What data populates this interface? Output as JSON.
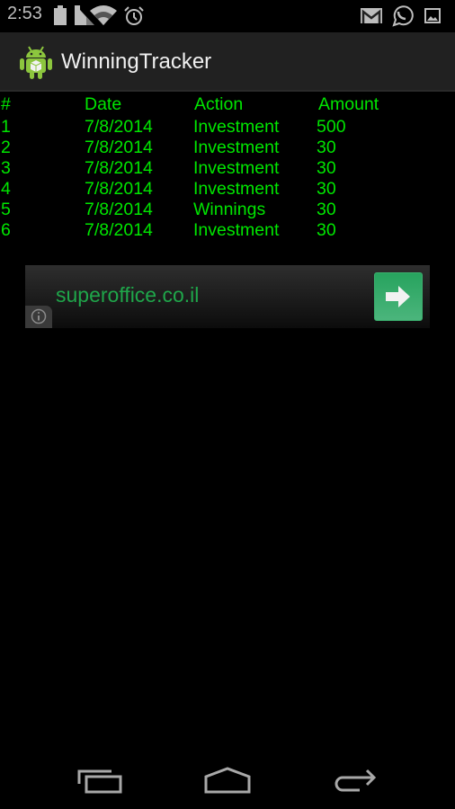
{
  "status_bar": {
    "time": "2:53",
    "left_icons": [
      "battery-icon",
      "signal-icon",
      "wifi-icon",
      "alarm-icon"
    ],
    "right_icons": [
      "gmail-icon",
      "whatsapp-icon",
      "gallery-icon"
    ]
  },
  "action_bar": {
    "app_icon": "android-app-icon",
    "title": "WinningTracker"
  },
  "table": {
    "columns": [
      "#",
      "Date",
      "Action",
      "Amount"
    ],
    "rows": [
      [
        "1",
        "7/8/2014",
        "Investment",
        "500"
      ],
      [
        "2",
        "7/8/2014",
        "Investment",
        "30"
      ],
      [
        "3",
        "7/8/2014",
        "Investment",
        "30"
      ],
      [
        "4",
        "7/8/2014",
        "Investment",
        "30"
      ],
      [
        "5",
        "7/8/2014",
        "Winnings",
        "30"
      ],
      [
        "6",
        "7/8/2014",
        "Investment",
        "30"
      ]
    ],
    "text_color": "#00e600"
  },
  "ad": {
    "text": "superoffice.co.il",
    "text_color": "#1fa64a",
    "button_icon": "arrow-right-icon",
    "button_color": "#2ea866",
    "info_icon": "info-icon"
  },
  "nav_bar": {
    "buttons": [
      "recent-apps",
      "home",
      "back"
    ]
  }
}
